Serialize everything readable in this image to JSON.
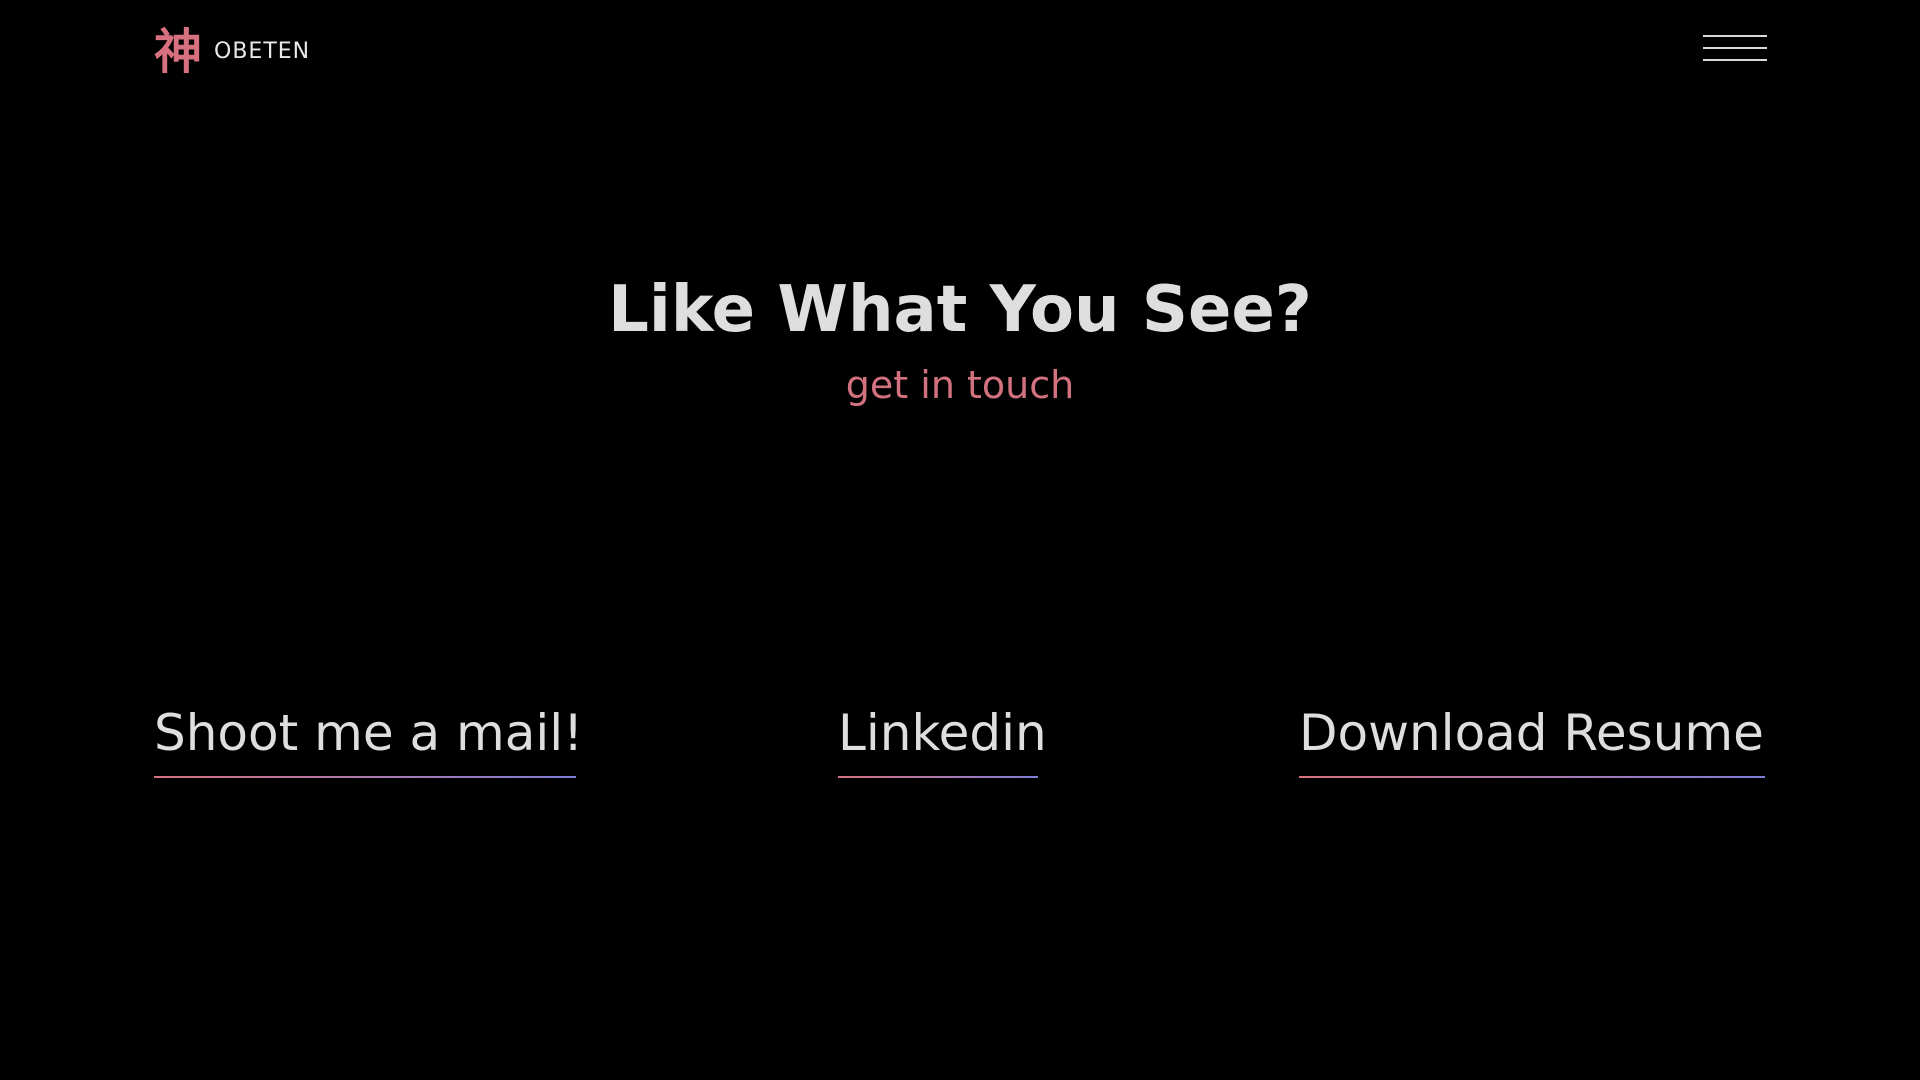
{
  "header": {
    "logo_glyph": "神",
    "logo_text": "OBETEN",
    "menu_icon": "hamburger-menu-icon"
  },
  "hero": {
    "title": "Like What You See?",
    "subtitle": "get in touch"
  },
  "contacts": {
    "mail": "Shoot me a mail!",
    "linkedin": "Linkedin",
    "resume": "Download Resume"
  },
  "colors": {
    "background": "#000000",
    "accent_pink": "#d8717f",
    "accent_blue": "#7f7fd8",
    "text": "#dedede"
  }
}
